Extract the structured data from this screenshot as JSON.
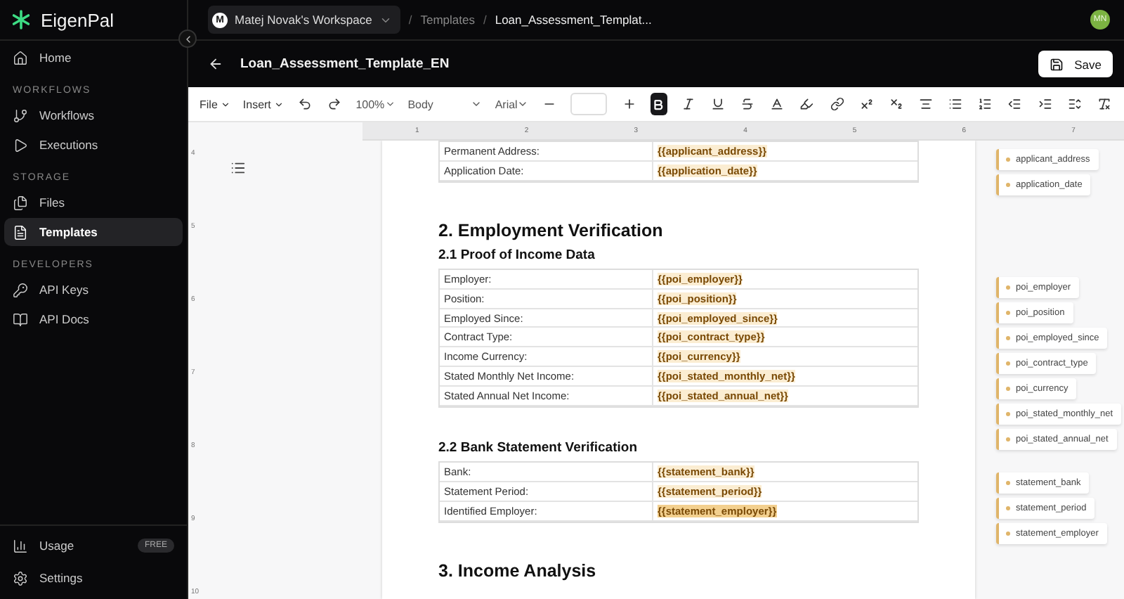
{
  "brand": {
    "name": "EigenPal"
  },
  "sidebar": {
    "sections": [
      {
        "items": [
          {
            "label": "Home",
            "selected": false
          }
        ]
      },
      {
        "heading": "WORKFLOWS",
        "items": [
          {
            "label": "Workflows",
            "selected": false
          },
          {
            "label": "Executions",
            "selected": false
          }
        ]
      },
      {
        "heading": "STORAGE",
        "items": [
          {
            "label": "Files",
            "selected": false
          },
          {
            "label": "Templates",
            "selected": true
          }
        ]
      },
      {
        "heading": "DEVELOPERS",
        "items": [
          {
            "label": "API Keys",
            "selected": false
          },
          {
            "label": "API Docs",
            "selected": false
          }
        ]
      }
    ],
    "footer": [
      {
        "label": "Usage",
        "badge": "FREE"
      },
      {
        "label": "Settings"
      }
    ]
  },
  "topbar": {
    "workspace_initial": "M",
    "workspace": "Matej Novak's Workspace",
    "breadcrumbs": [
      {
        "separator": "/",
        "label": "Templates"
      },
      {
        "separator": "/",
        "label": "Loan_Assessment_Templat..."
      }
    ],
    "avatar": "MN"
  },
  "header": {
    "title": "Loan_Assessment_Template_EN",
    "save": "Save"
  },
  "toolbar": {
    "file": "File",
    "insert": "Insert",
    "zoom": "100%",
    "style": "Body",
    "font": "Arial",
    "bold_active": true
  },
  "ruler": {
    "labels": [
      "1",
      "2",
      "3",
      "4",
      "5",
      "6",
      "7"
    ],
    "vertical": [
      "4",
      "5",
      "6",
      "7",
      "8",
      "9",
      "10"
    ]
  },
  "document": {
    "blocks": [
      {
        "kind": "table",
        "rows": [
          {
            "label": "Permanent Address:",
            "value": "{{applicant_address}}",
            "selected": false
          },
          {
            "label": "Application Date:",
            "value": "{{application_date}}",
            "selected": false
          }
        ]
      },
      {
        "kind": "h1",
        "text": "2. Employment Verification"
      },
      {
        "kind": "h2",
        "text": "2.1 Proof of Income Data"
      },
      {
        "kind": "table",
        "rows": [
          {
            "label": "Employer:",
            "value": "{{poi_employer}}",
            "selected": false
          },
          {
            "label": "Position:",
            "value": "{{poi_position}}",
            "selected": false
          },
          {
            "label": "Employed Since:",
            "value": "{{poi_employed_since}}",
            "selected": false
          },
          {
            "label": "Contract Type:",
            "value": "{{poi_contract_type}}",
            "selected": false
          },
          {
            "label": "Income Currency:",
            "value": "{{poi_currency}}",
            "selected": false
          },
          {
            "label": "Stated Monthly Net Income:",
            "value": "{{poi_stated_monthly_net}}",
            "selected": false
          },
          {
            "label": "Stated Annual Net Income:",
            "value": "{{poi_stated_annual_net}}",
            "selected": false
          }
        ]
      },
      {
        "kind": "h2",
        "text": "2.2 Bank Statement Verification"
      },
      {
        "kind": "table",
        "rows": [
          {
            "label": "Bank:",
            "value": "{{statement_bank}}",
            "selected": false
          },
          {
            "label": "Statement Period:",
            "value": "{{statement_period}}",
            "selected": false
          },
          {
            "label": "Identified Employer:",
            "value": "{{statement_employer}}",
            "selected": true
          }
        ]
      },
      {
        "kind": "h1",
        "text": "3. Income Analysis"
      }
    ]
  },
  "variables": [
    [
      "applicant_address",
      "application_date"
    ],
    [
      "poi_employer",
      "poi_position",
      "poi_employed_since",
      "poi_contract_type",
      "poi_currency",
      "poi_stated_monthly_net",
      "poi_stated_annual_net"
    ],
    [
      "statement_bank",
      "statement_period",
      "statement_employer"
    ]
  ]
}
